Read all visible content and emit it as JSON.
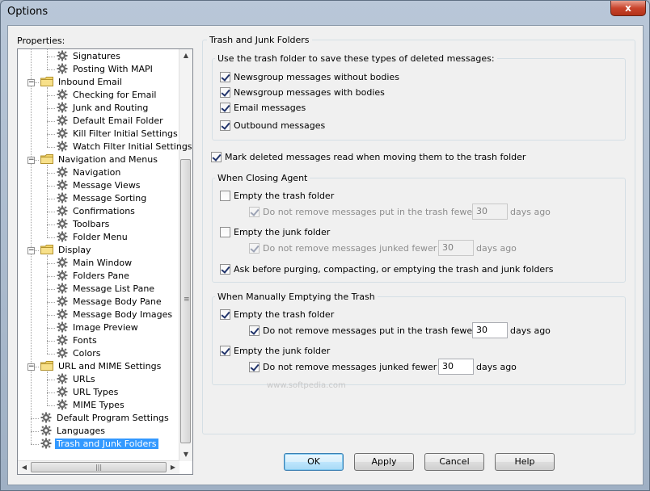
{
  "window": {
    "title": "Options",
    "close_glyph": "x"
  },
  "properties_label": "Properties:",
  "tree": {
    "items": [
      {
        "label": "Signatures",
        "kind": "gear"
      },
      {
        "label": "Posting With MAPI",
        "kind": "gear"
      },
      {
        "label": "Inbound Email",
        "kind": "folder"
      },
      {
        "label": "Checking for Email",
        "kind": "gear"
      },
      {
        "label": "Junk and Routing",
        "kind": "gear"
      },
      {
        "label": "Default Email Folder",
        "kind": "gear"
      },
      {
        "label": "Kill Filter Initial Settings",
        "kind": "gear"
      },
      {
        "label": "Watch Filter Initial Settings",
        "kind": "gear"
      },
      {
        "label": "Navigation and Menus",
        "kind": "folder"
      },
      {
        "label": "Navigation",
        "kind": "gear"
      },
      {
        "label": "Message Views",
        "kind": "gear"
      },
      {
        "label": "Message Sorting",
        "kind": "gear"
      },
      {
        "label": "Confirmations",
        "kind": "gear"
      },
      {
        "label": "Toolbars",
        "kind": "gear"
      },
      {
        "label": "Folder Menu",
        "kind": "gear"
      },
      {
        "label": "Display",
        "kind": "folder"
      },
      {
        "label": "Main Window",
        "kind": "gear"
      },
      {
        "label": "Folders Pane",
        "kind": "gear"
      },
      {
        "label": "Message List Pane",
        "kind": "gear"
      },
      {
        "label": "Message Body Pane",
        "kind": "gear"
      },
      {
        "label": "Message Body Images",
        "kind": "gear"
      },
      {
        "label": "Image Preview",
        "kind": "gear"
      },
      {
        "label": "Fonts",
        "kind": "gear"
      },
      {
        "label": "Colors",
        "kind": "gear"
      },
      {
        "label": "URL and MIME Settings",
        "kind": "folder"
      },
      {
        "label": "URLs",
        "kind": "gear"
      },
      {
        "label": "URL Types",
        "kind": "gear"
      },
      {
        "label": "MIME Types",
        "kind": "gear"
      },
      {
        "label": "Default Program Settings",
        "kind": "gear"
      },
      {
        "label": "Languages",
        "kind": "gear"
      },
      {
        "label": "Trash and Junk Folders",
        "kind": "gear",
        "selected": true
      }
    ],
    "expander_glyph": "−"
  },
  "main": {
    "section_title": "Trash and Junk Folders",
    "use_trash": {
      "label": "Use the trash folder to save these types of deleted messages:",
      "newsgroup_no_bodies": "Newsgroup messages without bodies",
      "newsgroup_bodies": "Newsgroup messages with bodies",
      "email": "Email messages",
      "outbound": "Outbound messages"
    },
    "mark_read": "Mark deleted messages read when moving them to the trash folder",
    "closing": {
      "label": "When Closing Agent",
      "empty_trash": "Empty the trash folder",
      "trash_keep": "Do not remove messages put in the trash fewer than",
      "trash_days": "30",
      "days_ago": "days ago",
      "empty_junk": "Empty the junk folder",
      "junk_keep": "Do not remove messages junked fewer than",
      "junk_days": "30",
      "ask_before": "Ask before purging, compacting, or emptying the trash and junk folders"
    },
    "manual": {
      "label": "When Manually Emptying the Trash",
      "empty_trash": "Empty the trash folder",
      "trash_keep": "Do not remove messages put in the trash fewer than",
      "trash_days": "30",
      "days_ago": "days ago",
      "empty_junk": "Empty the junk folder",
      "junk_keep": "Do not remove messages junked fewer than",
      "junk_days": "30"
    }
  },
  "buttons": {
    "ok": "OK",
    "apply": "Apply",
    "cancel": "Cancel",
    "help": "Help"
  },
  "watermark": "www.softpedia.com",
  "scroll_glyphs": {
    "up": "▲",
    "down": "▼",
    "left": "◀",
    "right": "▶",
    "grip_h": "|||",
    "grip_v": "≡"
  },
  "colors": {
    "selection": "#3399ff",
    "default_button_border": "#3c7fb1"
  }
}
